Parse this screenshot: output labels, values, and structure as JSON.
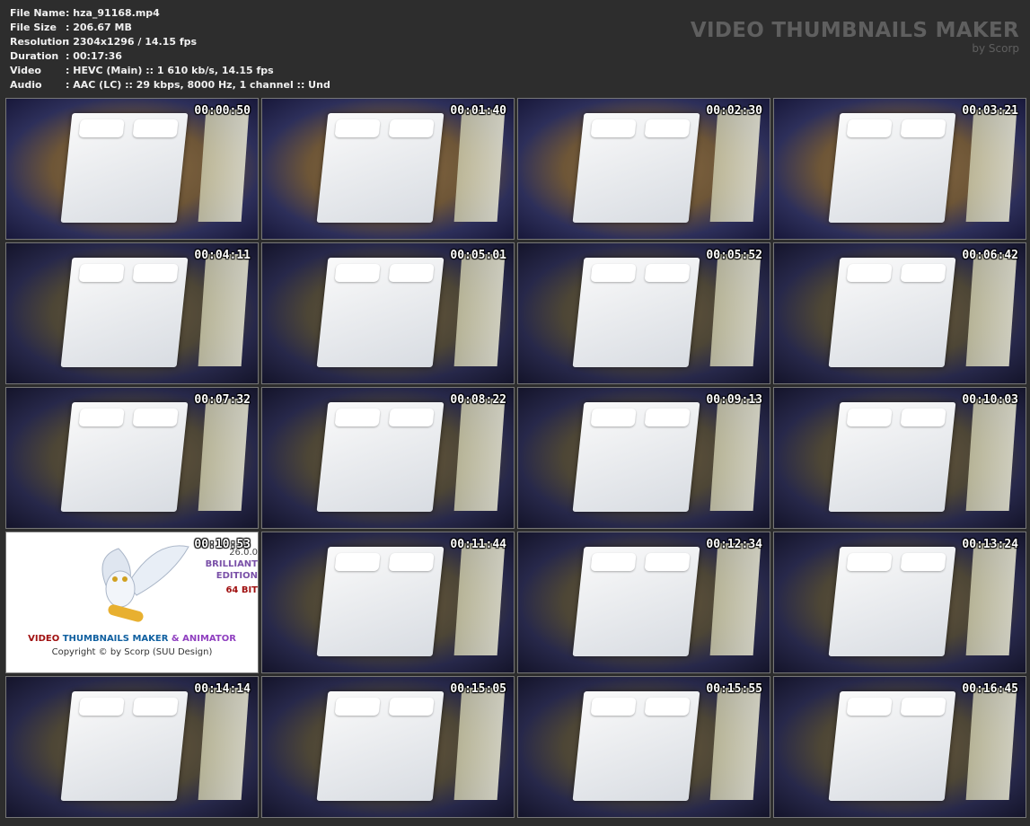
{
  "info": [
    {
      "label": "File Name",
      "value": "hza_91168.mp4"
    },
    {
      "label": "File Size",
      "value": "206.67 MB"
    },
    {
      "label": "Resolution",
      "value": "2304x1296 / 14.15 fps"
    },
    {
      "label": "Duration",
      "value": "00:17:36"
    },
    {
      "label": "Video",
      "value": "HEVC (Main) :: 1 610 kb/s, 14.15 fps"
    },
    {
      "label": "Audio",
      "value": "AAC (LC) :: 29 kbps, 8000 Hz, 1 channel :: Und"
    }
  ],
  "brand": {
    "title": "VIDEO THUMBNAILS MAKER",
    "subtitle": "by Scorp"
  },
  "thumbnails": [
    "00:00:50",
    "00:01:40",
    "00:02:30",
    "00:03:21",
    "00:04:11",
    "00:05:01",
    "00:05:52",
    "00:06:42",
    "00:07:32",
    "00:08:22",
    "00:09:13",
    "00:10:03",
    "00:10:53",
    "00:11:44",
    "00:12:34",
    "00:13:24",
    "00:14:14",
    "00:15:05",
    "00:15:55",
    "00:16:45"
  ],
  "logo_tile": {
    "version": "26.0.0",
    "edition1": "BRILLIANT",
    "edition2": "EDITION",
    "bits": "64 BIT",
    "line_video": "VIDEO",
    "line_thumbs": "THUMBNAILS MAKER",
    "line_anim": "& ANIMATOR",
    "copyright": "Copyright © by Scorp (SUU Design)",
    "colors": {
      "video": "#a01010",
      "thumbs": "#1060a0",
      "anim": "#9040c0",
      "edition": "#7a50a8",
      "bits": "#a01010"
    }
  }
}
